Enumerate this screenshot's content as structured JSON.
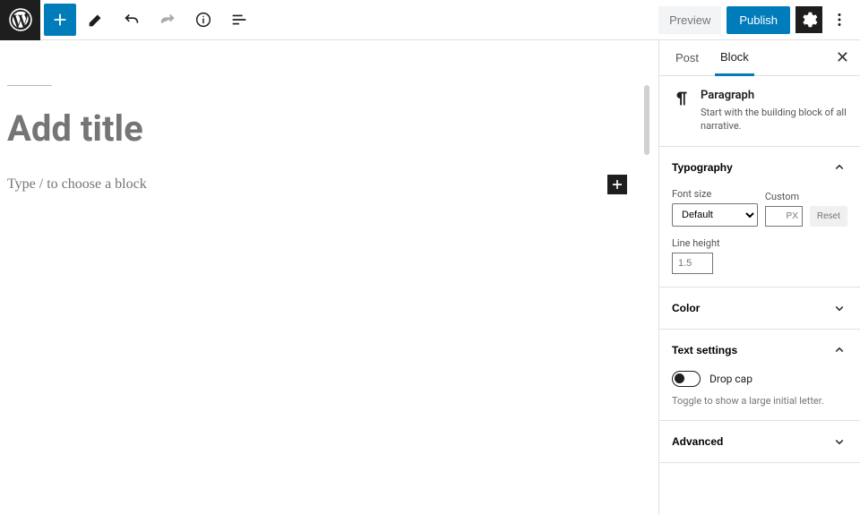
{
  "header": {
    "preview_label": "Preview",
    "publish_label": "Publish"
  },
  "editor": {
    "title_placeholder": "Add title",
    "block_placeholder": "Type / to choose a block"
  },
  "sidebar": {
    "tabs": {
      "post": "Post",
      "block": "Block"
    },
    "block_info": {
      "title": "Paragraph",
      "desc": "Start with the building block of all narrative."
    },
    "typography": {
      "title": "Typography",
      "font_size_label": "Font size",
      "font_size_value": "Default",
      "custom_label": "Custom",
      "custom_unit": "PX",
      "reset_label": "Reset",
      "line_height_label": "Line height",
      "line_height_value": "1.5"
    },
    "color": {
      "title": "Color"
    },
    "text_settings": {
      "title": "Text settings",
      "drop_cap_label": "Drop cap",
      "help": "Toggle to show a large initial letter."
    },
    "advanced": {
      "title": "Advanced"
    }
  }
}
